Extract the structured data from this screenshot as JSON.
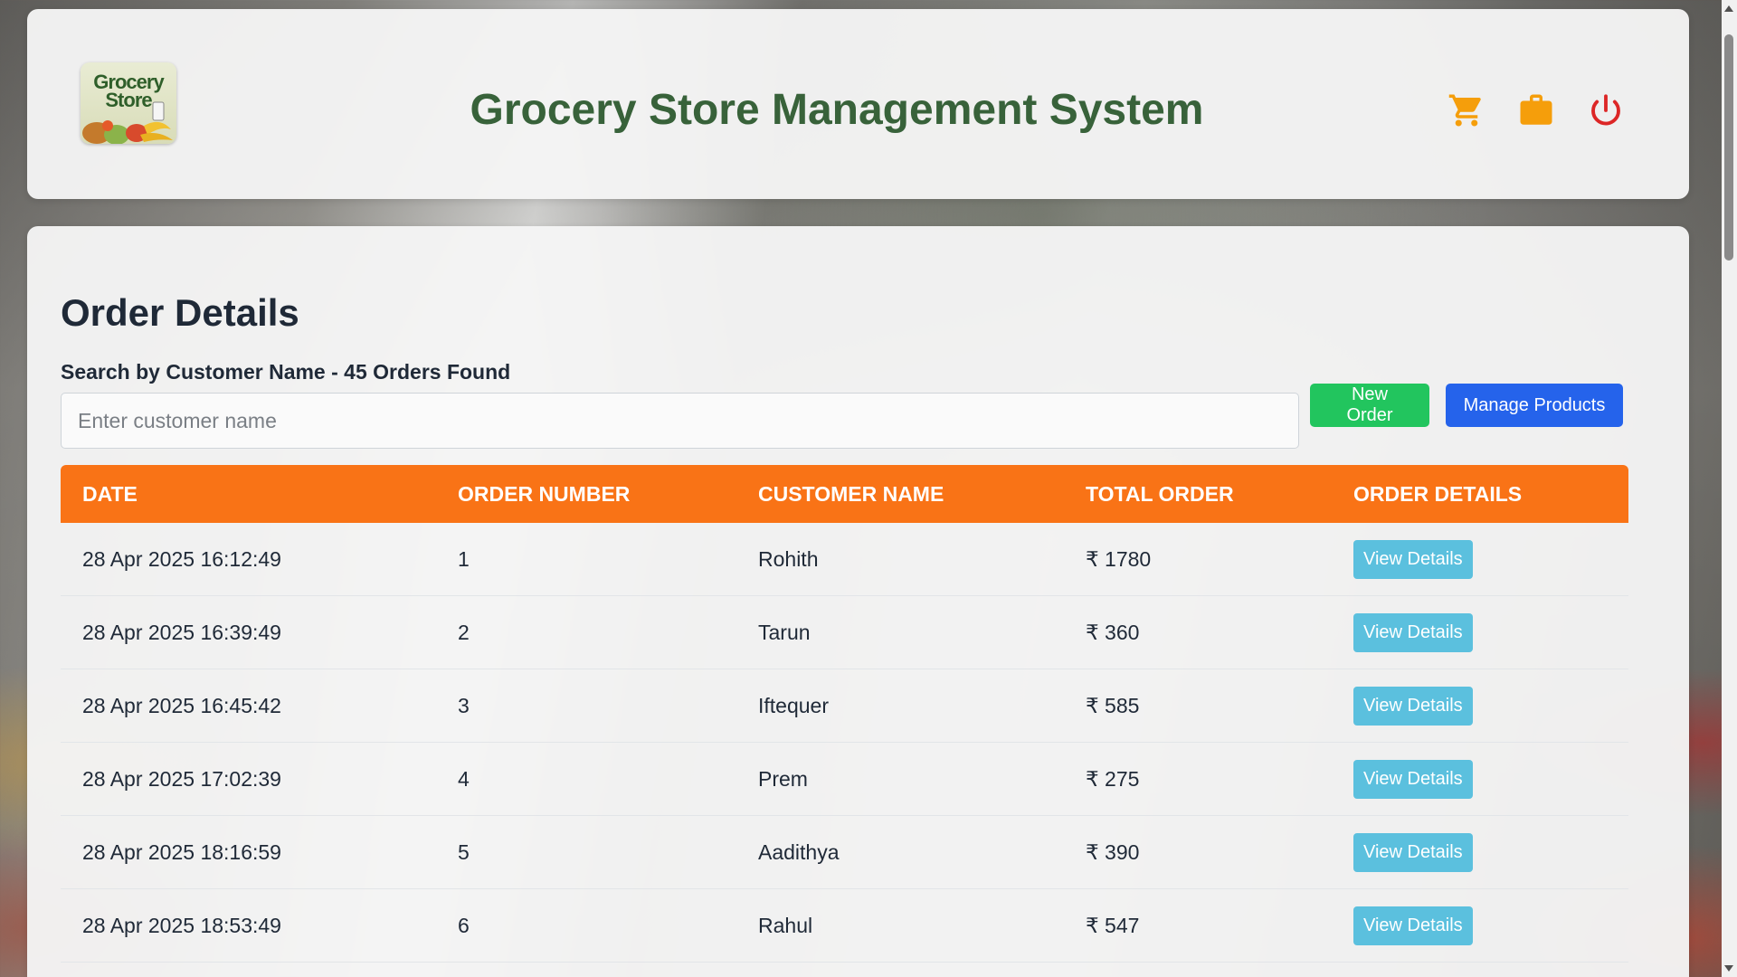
{
  "header": {
    "logo_text": "Grocery Store",
    "title": "Grocery Store Management System",
    "icons": [
      "cart-icon",
      "briefcase-icon",
      "power-icon"
    ]
  },
  "main": {
    "title": "Order Details",
    "search_label": "Search by Customer Name - 45 Orders Found",
    "search_placeholder": "Enter customer name",
    "search_value": "",
    "new_order_label": "New Order",
    "manage_products_label": "Manage Products",
    "table": {
      "headers": {
        "date": "Date",
        "order_number": "Order Number",
        "customer_name": "Customer Name",
        "total_order": "Total Order",
        "order_details": "Order Details"
      },
      "rows": [
        {
          "date": "28 Apr 2025 16:12:49",
          "order_number": "1",
          "customer": "Rohith",
          "total": "₹ 1780",
          "action": "View Details"
        },
        {
          "date": "28 Apr 2025 16:39:49",
          "order_number": "2",
          "customer": "Tarun",
          "total": "₹ 360",
          "action": "View Details"
        },
        {
          "date": "28 Apr 2025 16:45:42",
          "order_number": "3",
          "customer": "Iftequer",
          "total": "₹ 585",
          "action": "View Details"
        },
        {
          "date": "28 Apr 2025 17:02:39",
          "order_number": "4",
          "customer": "Prem",
          "total": "₹ 275",
          "action": "View Details"
        },
        {
          "date": "28 Apr 2025 18:16:59",
          "order_number": "5",
          "customer": "Aadithya",
          "total": "₹ 390",
          "action": "View Details"
        },
        {
          "date": "28 Apr 2025 18:53:49",
          "order_number": "6",
          "customer": "Rahul",
          "total": "₹ 547",
          "action": "View Details"
        }
      ]
    }
  },
  "colors": {
    "title_green": "#38623a",
    "header_orange": "#f97316",
    "new_order_green": "#22c55e",
    "manage_blue": "#2563eb",
    "view_details_cyan": "#5bc0de",
    "cart_orange": "#f59e0b",
    "power_red": "#dc2626"
  }
}
